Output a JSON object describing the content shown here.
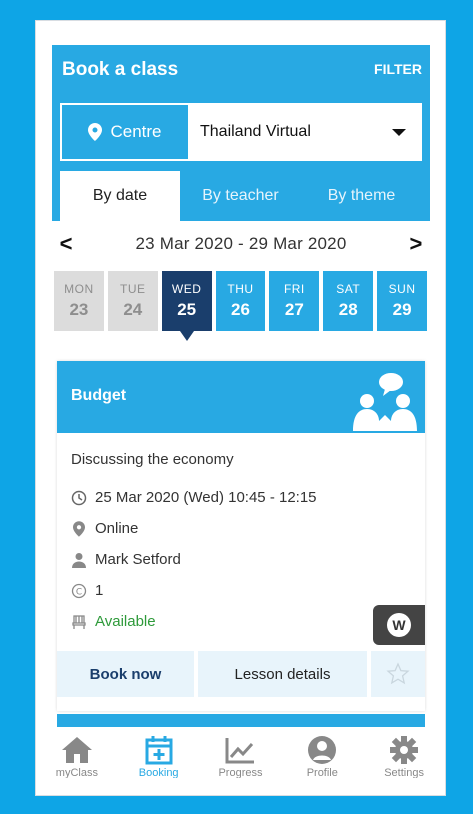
{
  "header": {
    "title": "Book a class",
    "filter_label": "FILTER",
    "centre_label": "Centre",
    "centre_value": "Thailand Virtual"
  },
  "tabs": [
    {
      "label": "By date",
      "active": true
    },
    {
      "label": "By teacher",
      "active": false
    },
    {
      "label": "By theme",
      "active": false
    }
  ],
  "week": {
    "range": "23 Mar 2020 - 29 Mar 2020",
    "prev": "<",
    "next": ">"
  },
  "days": [
    {
      "name": "MON",
      "date": "23",
      "state": "past"
    },
    {
      "name": "TUE",
      "date": "24",
      "state": "past"
    },
    {
      "name": "WED",
      "date": "25",
      "state": "selected"
    },
    {
      "name": "THU",
      "date": "26",
      "state": "future"
    },
    {
      "name": "FRI",
      "date": "27",
      "state": "future"
    },
    {
      "name": "SAT",
      "date": "28",
      "state": "future"
    },
    {
      "name": "SUN",
      "date": "29",
      "state": "future"
    }
  ],
  "class_card": {
    "title": "Budget",
    "topic": "Discussing the economy",
    "datetime": "25 Mar 2020 (Wed) 10:45 - 12:15",
    "location": "Online",
    "teacher": "Mark Setford",
    "credits": "1",
    "availability": "Available",
    "badge": "W",
    "book_label": "Book now",
    "details_label": "Lesson details"
  },
  "bottom_nav": [
    {
      "label": "myClass",
      "icon": "home-icon",
      "active": false
    },
    {
      "label": "Booking",
      "icon": "calendar-plus-icon",
      "active": true
    },
    {
      "label": "Progress",
      "icon": "chart-icon",
      "active": false
    },
    {
      "label": "Profile",
      "icon": "person-icon",
      "active": false
    },
    {
      "label": "Settings",
      "icon": "gear-icon",
      "active": false
    }
  ],
  "colors": {
    "accent": "#28a9e3",
    "selected_day": "#1a3e6c",
    "available": "#2e9a3a"
  }
}
